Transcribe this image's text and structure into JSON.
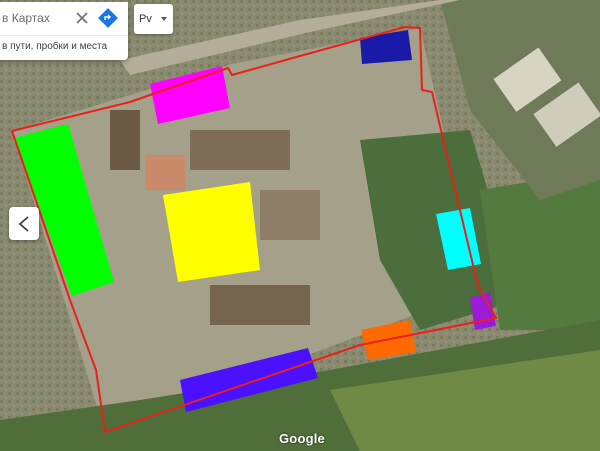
{
  "search": {
    "text": "в Картах",
    "hint": "в пути, пробки и места"
  },
  "map_type": {
    "selected": "Рv"
  },
  "watermark": "Google",
  "icons": {
    "clear": "close-icon",
    "directions": "directions-icon",
    "collapse": "chevron-left-icon"
  },
  "colors": {
    "boundary": "#e8211a",
    "green": "#00ff00",
    "yellow": "#ffff00",
    "magenta": "#ff00ff",
    "dark_blue": "#1a1aa8",
    "cyan": "#00ffff",
    "purple": "#9b1bd6",
    "orange": "#ff6a00",
    "blue_violet": "#4a10ff",
    "directions_blue": "#1a73e8"
  }
}
